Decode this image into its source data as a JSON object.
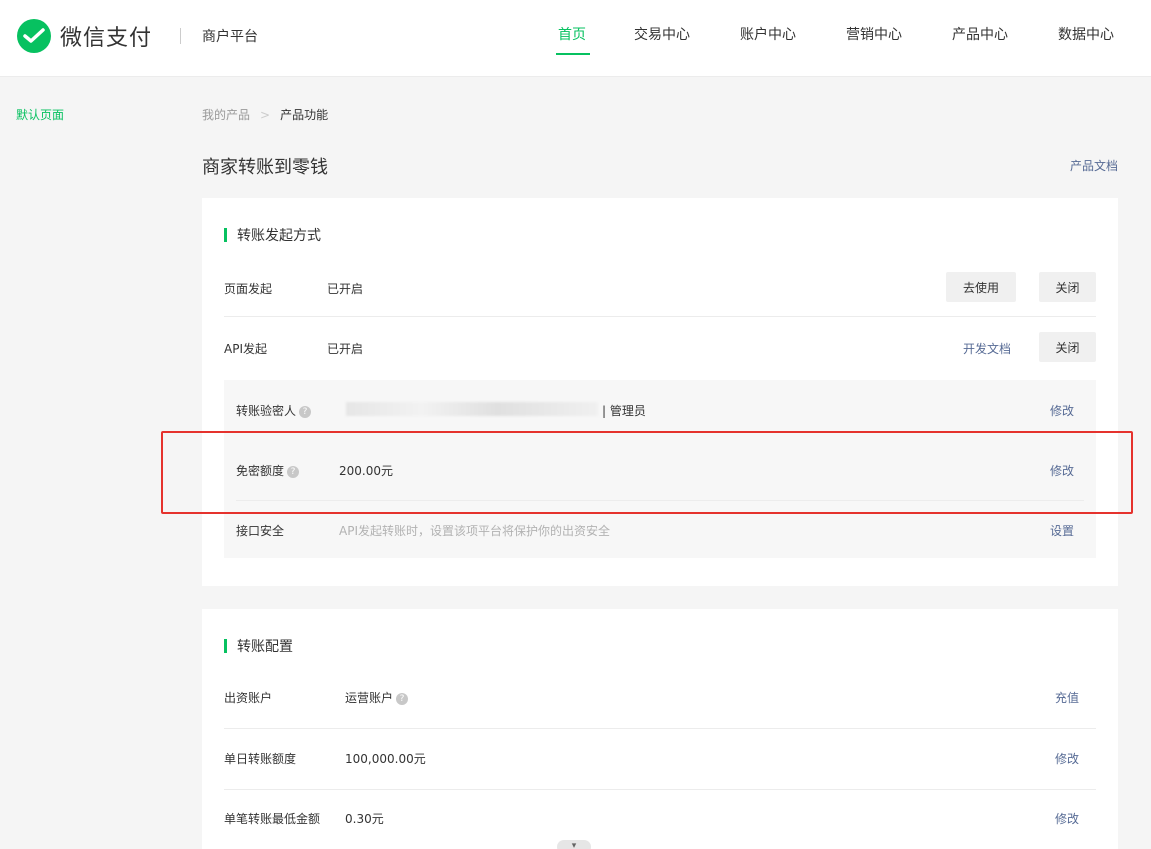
{
  "header": {
    "logo_text": "微信支付",
    "platform": "商户平台",
    "nav": [
      "首页",
      "交易中心",
      "账户中心",
      "营销中心",
      "产品中心",
      "数据中心"
    ],
    "active_index": 0
  },
  "sidebar": {
    "items": [
      {
        "label": "默认页面"
      }
    ]
  },
  "breadcrumb": {
    "items": [
      "我的产品",
      "产品功能"
    ],
    "separator": ">"
  },
  "page_title": "商家转账到零钱",
  "product_doc": "产品文档",
  "initiation": {
    "title": "转账发起方式",
    "page": {
      "label": "页面发起",
      "status": "已开启",
      "use_btn": "去使用",
      "close_btn": "关闭"
    },
    "api": {
      "label": "API发起",
      "status": "已开启",
      "doc_link": "开发文档",
      "close_btn": "关闭"
    },
    "verifier": {
      "label": "转账验密人",
      "role": "| 管理员",
      "action": "修改"
    },
    "free_limit": {
      "label": "免密额度",
      "value": "200.00元",
      "action": "修改"
    },
    "security": {
      "label": "接口安全",
      "hint": "API发起转账时，设置该项平台将保护你的出资安全",
      "action": "设置"
    }
  },
  "config": {
    "title": "转账配置",
    "funding": {
      "label": "出资账户",
      "value": "运营账户",
      "action": "充值"
    },
    "daily_limit": {
      "label": "单日转账额度",
      "value": "100,000.00元",
      "action": "修改"
    },
    "min_amount": {
      "label": "单笔转账最低金额",
      "value": "0.30元",
      "action": "修改"
    }
  },
  "colors": {
    "accent": "#07c160",
    "link": "#576b95",
    "highlight": "#e5322d"
  }
}
